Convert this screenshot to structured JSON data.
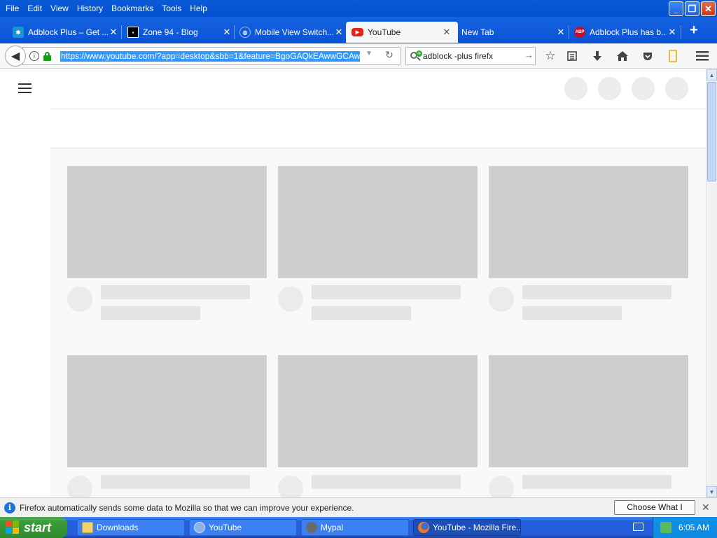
{
  "menubar": {
    "items": [
      "File",
      "Edit",
      "View",
      "History",
      "Bookmarks",
      "Tools",
      "Help"
    ]
  },
  "window_controls": {
    "minimize": "_",
    "maximize": "❐",
    "close": "✕"
  },
  "tabs": [
    {
      "title": "Adblock Plus – Get ...",
      "icon": "abp-puzzle-icon"
    },
    {
      "title": "Zone 94 - Blog",
      "icon": "zone94-icon"
    },
    {
      "title": "Mobile View Switch...",
      "icon": "globe-icon"
    },
    {
      "title": "YouTube",
      "icon": "youtube-icon",
      "active": true
    },
    {
      "title": "New Tab",
      "icon": ""
    },
    {
      "title": "Adblock Plus has b...",
      "icon": "abp-icon"
    }
  ],
  "newtab_label": "+",
  "urlbar": {
    "url": "https://www.youtube.com/?app=desktop&sbb=1&feature=BgoGAQkEAwwGCAwNBAcG..."
  },
  "searchbar": {
    "query": "adblock -plus firefx"
  },
  "toolbar_icons": [
    "bookmark-star-icon",
    "reader-list-icon",
    "download-icon",
    "home-icon",
    "pocket-icon",
    "mobile-icon",
    "menu-icon"
  ],
  "notification": {
    "text": "Firefox automatically sends some data to Mozilla so that we can improve your experience.",
    "button": "Choose What I Share"
  },
  "taskbar": {
    "start": "start",
    "tasks": [
      {
        "label": "Downloads",
        "icon": "folder-icon"
      },
      {
        "label": "YouTube",
        "icon": "globe-icon"
      },
      {
        "label": "Mypal",
        "icon": "mypal-icon"
      },
      {
        "label": "YouTube - Mozilla Fire...",
        "icon": "firefox-icon",
        "active": true
      }
    ],
    "clock": "6:05 AM"
  },
  "colors": {
    "titlebar": "#0a5bd8",
    "selection": "#3399ff",
    "skeleton_thumb": "#cecece",
    "skeleton_line": "#e5e5e5",
    "start_green": "#3a9a3a"
  }
}
